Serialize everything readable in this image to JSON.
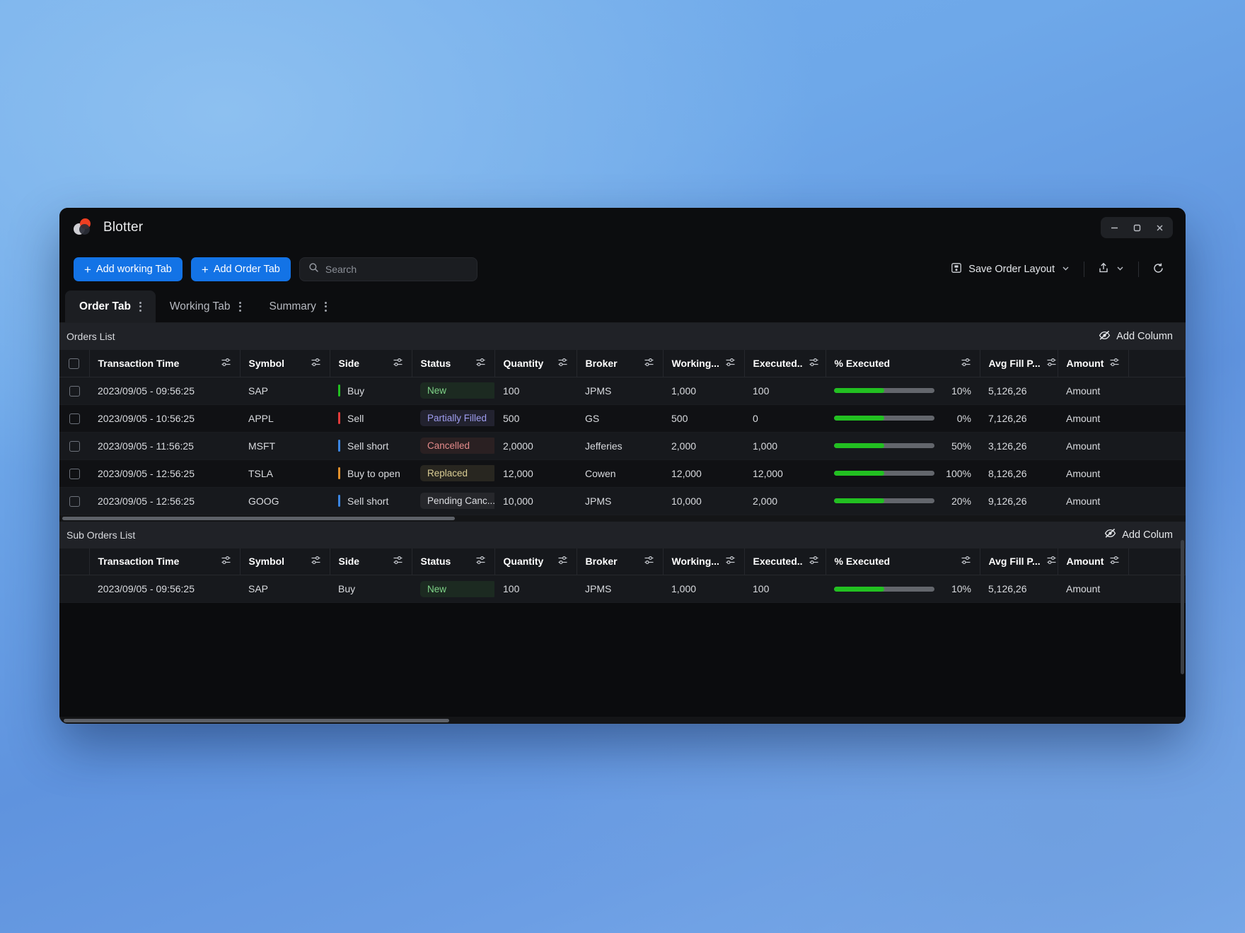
{
  "window": {
    "app_title": "Blotter",
    "controls": {
      "minimize": "minimize-icon",
      "maximize": "maximize-icon",
      "close": "close-icon"
    },
    "logo_icon": "blotter-logo-icon"
  },
  "toolbar": {
    "add_working_tab": "Add working Tab",
    "add_order_tab": "Add Order Tab",
    "plus": "+",
    "search": {
      "value": "",
      "placeholder": "Search",
      "icon": "search-icon"
    },
    "save_layout": "Save Order Layout",
    "save_icon": "save-icon",
    "share_icon": "share-icon",
    "refresh_icon": "refresh-icon",
    "chevron_icon": "chevron-down-icon"
  },
  "tabs": [
    {
      "label": "Order Tab",
      "active": true
    },
    {
      "label": "Working Tab",
      "active": false
    },
    {
      "label": "Summary",
      "active": false
    }
  ],
  "orders_panel": {
    "title": "Orders List",
    "add_column_label": "Add Column",
    "add_column_icon": "eye-off-icon",
    "columns": [
      "Transaction Time",
      "Symbol",
      "Side",
      "Status",
      "Quantity",
      "Broker",
      "Working...",
      "Executed..",
      "% Executed",
      "Avg Fill P...",
      "Amount"
    ],
    "column_filter_icon": "sliders-icon",
    "rows": [
      {
        "checked": false,
        "transaction_time": "2023/09/05 - 09:56:25",
        "symbol": "SAP",
        "side": "Buy",
        "side_color": "#22c021",
        "status": "New",
        "status_color": "#7fd488",
        "status_bg": "#1c2a21",
        "quantity": "100",
        "broker": "JPMS",
        "working": "1,000",
        "executed": "100",
        "percent_executed": "10%",
        "bar_fill": 50,
        "avg_fill_price": "5,126,26",
        "amount": "Amount"
      },
      {
        "checked": false,
        "transaction_time": "2023/09/05 - 10:56:25",
        "symbol": "APPL",
        "side": "Sell",
        "side_color": "#e23b3b",
        "status": "Partially Filled",
        "status_color": "#9f9df0",
        "status_bg": "#22222f",
        "quantity": "500",
        "broker": "GS",
        "working": "500",
        "executed": "0",
        "percent_executed": "0%",
        "bar_fill": 50,
        "avg_fill_price": "7,126,26",
        "amount": "Amount"
      },
      {
        "checked": false,
        "transaction_time": "2023/09/05 - 11:56:25",
        "symbol": "MSFT",
        "side": "Sell short",
        "side_color": "#3b86e2",
        "status": "Cancelled",
        "status_color": "#e58b8b",
        "status_bg": "#2a2022",
        "quantity": "2,0000",
        "broker": "Jefferies",
        "working": "2,000",
        "executed": "1,000",
        "percent_executed": "50%",
        "bar_fill": 50,
        "avg_fill_price": "3,126,26",
        "amount": "Amount"
      },
      {
        "checked": false,
        "transaction_time": "2023/09/05 - 12:56:25",
        "symbol": "TSLA",
        "side": "Buy to open",
        "side_color": "#e2912c",
        "status": "Replaced",
        "status_color": "#d9cc93",
        "status_bg": "#282620",
        "quantity": "12,000",
        "broker": "Cowen",
        "working": "12,000",
        "executed": "12,000",
        "percent_executed": "100%",
        "bar_fill": 50,
        "avg_fill_price": "8,126,26",
        "amount": "Amount"
      },
      {
        "checked": false,
        "transaction_time": "2023/09/05 - 12:56:25",
        "symbol": "GOOG",
        "side": "Sell short",
        "side_color": "#3b86e2",
        "status": "Pending Canc...",
        "status_color": "#dcdee2",
        "status_bg": "#26272b",
        "quantity": "10,000",
        "broker": "JPMS",
        "working": "10,000",
        "executed": "2,000",
        "percent_executed": "20%",
        "bar_fill": 50,
        "avg_fill_price": "9,126,26",
        "amount": "Amount"
      }
    ]
  },
  "sub_orders_panel": {
    "title": "Sub Orders List",
    "add_column_label": "Add Colum",
    "add_column_icon": "eye-off-icon",
    "columns": [
      "Transaction Time",
      "Symbol",
      "Side",
      "Status",
      "Quantity",
      "Broker",
      "Working...",
      "Executed..",
      "% Executed",
      "Avg Fill P...",
      "Amount"
    ],
    "column_filter_icon": "sliders-icon",
    "rows": [
      {
        "transaction_time": "2023/09/05 - 09:56:25",
        "symbol": "SAP",
        "side": "Buy",
        "status": "New",
        "status_color": "#7fd488",
        "status_bg": "#1c2a21",
        "quantity": "100",
        "broker": "JPMS",
        "working": "1,000",
        "executed": "100",
        "percent_executed": "10%",
        "bar_fill": 50,
        "avg_fill_price": "5,126,26",
        "amount": "Amount"
      }
    ]
  },
  "colors": {
    "accent": "#1373e6",
    "progress": "#22c021",
    "window_bg": "#0c0d0f"
  }
}
